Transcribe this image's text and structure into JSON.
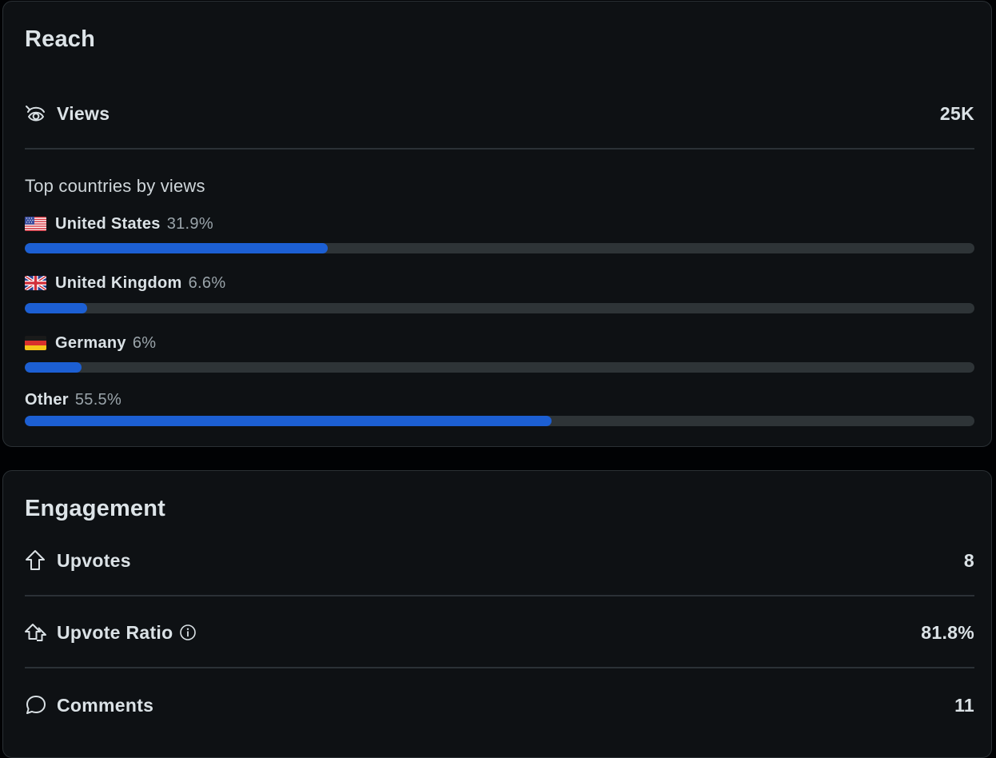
{
  "reach": {
    "title": "Reach",
    "views": {
      "label": "Views",
      "value": "25K",
      "icon": "eye-icon"
    },
    "top_countries_title": "Top countries by views",
    "countries": [
      {
        "name": "United States",
        "percent_text": "31.9%",
        "percent": 31.9,
        "flag": "us-flag"
      },
      {
        "name": "United Kingdom",
        "percent_text": "6.6%",
        "percent": 6.6,
        "flag": "uk-flag"
      },
      {
        "name": "Germany",
        "percent_text": "6%",
        "percent": 6.0,
        "flag": "de-flag"
      },
      {
        "name": "Other",
        "percent_text": "55.5%",
        "percent": 55.5,
        "flag": ""
      }
    ]
  },
  "engagement": {
    "title": "Engagement",
    "upvotes": {
      "label": "Upvotes",
      "value": "8",
      "icon": "arrow-up-icon"
    },
    "upvote_ratio": {
      "label": "Upvote Ratio",
      "value": "81.8%",
      "icon": "double-arrow-up-icon",
      "info_icon": "info-icon"
    },
    "comments": {
      "label": "Comments",
      "value": "11",
      "icon": "speech-bubble-icon"
    }
  },
  "colors": {
    "background": "#0e1114",
    "bar_fill": "#1c5fd3",
    "bar_track": "#2e3437",
    "text": "#dbe2e6",
    "muted_text": "#9aa4aa"
  }
}
